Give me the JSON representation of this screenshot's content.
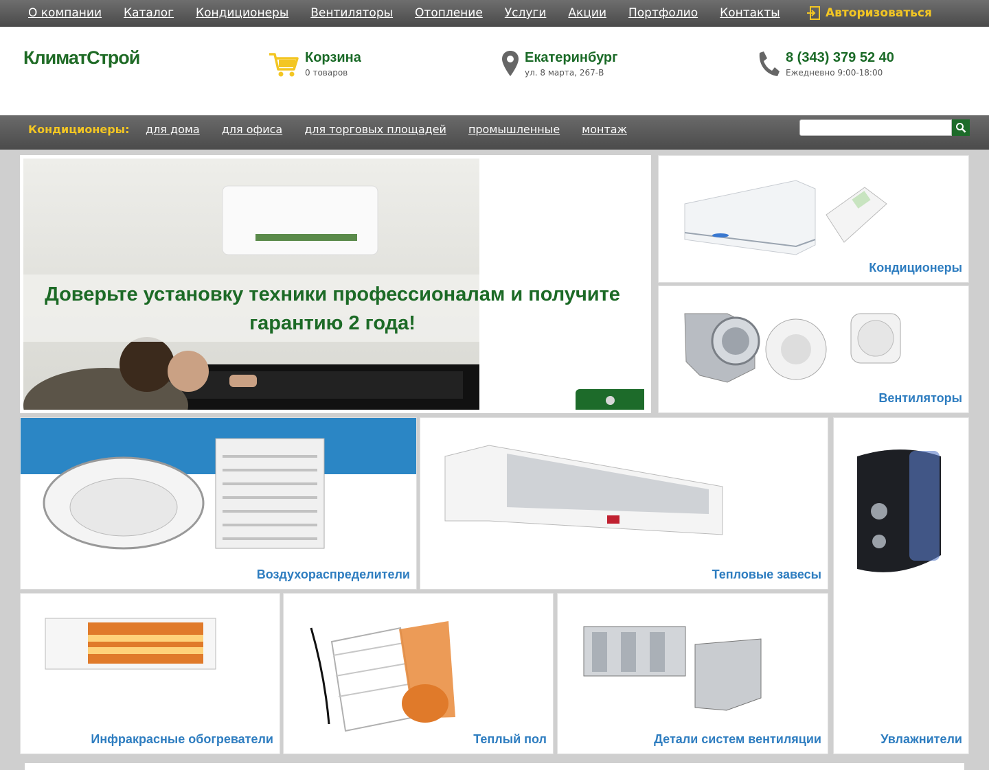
{
  "topnav": {
    "items": [
      "О компании",
      "Каталог",
      "Кондиционеры",
      "Вентиляторы",
      "Отопление",
      "Услуги",
      "Акции",
      "Портфолио",
      "Контакты"
    ],
    "login_label": "Авторизоваться"
  },
  "header": {
    "logo_text": "КлиматСтрой",
    "cart": {
      "title": "Корзина",
      "count_text": "0 товаров"
    },
    "location": {
      "city": "Екатеринбург",
      "address": "ул. 8 марта, 267-В"
    },
    "phone": {
      "number": "8 (343) 379 52 40",
      "hours": "Ежедневно 9:00-18:00"
    }
  },
  "subnav": {
    "lead": "Кондиционеры:",
    "links": [
      "для дома",
      "для офиса",
      "для торговых площадей",
      "промышленные",
      "монтаж"
    ],
    "search_placeholder": ""
  },
  "slider": {
    "caption": "Доверьте установку техники профессионалам и получите гарантию 2 года!"
  },
  "categories": {
    "conditioners": "Кондиционеры",
    "fans": "Вентиляторы",
    "air_distributors": "Воздухораспределители",
    "heat_curtains": "Тепловые завесы",
    "humidifiers": "Увлажнители",
    "infrared_heaters": "Инфракрасные обогреватели",
    "warm_floor": "Теплый пол",
    "ventilation_parts": "Детали систем вентиляции"
  },
  "colors": {
    "brand_green": "#1d6b2a",
    "accent_yellow": "#f3c623",
    "label_blue": "#2e7dc0"
  }
}
